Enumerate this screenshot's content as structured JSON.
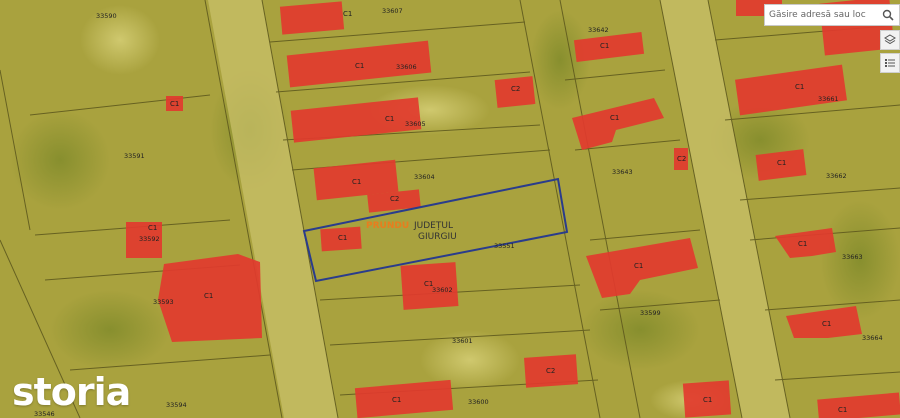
{
  "search": {
    "placeholder": "Găsire adresă sau loc"
  },
  "toolbar": {
    "icons": [
      "search-icon",
      "layers-icon",
      "legend-icon"
    ]
  },
  "logo": {
    "text": "storia"
  },
  "locality": {
    "name": "PRUNDU",
    "county_line1": "JUDEȚUL",
    "county_line2": "GIURGIU"
  },
  "colors": {
    "building": "#e23a2e",
    "parcel_highlight": "#2a3c8c",
    "base": "#a9a23e"
  },
  "parcels": [
    {
      "id": "33590",
      "label": "33590"
    },
    {
      "id": "33607",
      "label": "33607"
    },
    {
      "id": "33606",
      "label": "33606"
    },
    {
      "id": "33605",
      "label": "33605"
    },
    {
      "id": "33604",
      "label": "33604"
    },
    {
      "id": "33591",
      "label": "33591"
    },
    {
      "id": "33592",
      "label": "33592"
    },
    {
      "id": "33593",
      "label": "33593"
    },
    {
      "id": "33602",
      "label": "33602"
    },
    {
      "id": "33601",
      "label": "33601"
    },
    {
      "id": "33600",
      "label": "33600"
    },
    {
      "id": "33599",
      "label": "33599"
    },
    {
      "id": "33594",
      "label": "33594"
    },
    {
      "id": "33546",
      "label": "33546"
    },
    {
      "id": "33642",
      "label": "33642"
    },
    {
      "id": "33643",
      "label": "33643"
    },
    {
      "id": "33661",
      "label": "33661"
    },
    {
      "id": "33662",
      "label": "33662"
    },
    {
      "id": "33663",
      "label": "33663"
    },
    {
      "id": "33664",
      "label": "33664"
    },
    {
      "id": "33551",
      "label": "33551"
    }
  ],
  "buildings": [
    {
      "id": "b-33607",
      "label": "C1"
    },
    {
      "id": "b-33606",
      "label": "C1"
    },
    {
      "id": "b-33605",
      "label": "C1"
    },
    {
      "id": "b-33605-2",
      "label": "C2"
    },
    {
      "id": "b-33604",
      "label": "C1"
    },
    {
      "id": "b-33604-2",
      "label": "C2"
    },
    {
      "id": "b-33590",
      "label": "C1"
    },
    {
      "id": "b-33592",
      "label": "C1"
    },
    {
      "id": "b-33593",
      "label": "C1"
    },
    {
      "id": "b-target",
      "label": "C1"
    },
    {
      "id": "b-33602",
      "label": "C1"
    },
    {
      "id": "b-33600",
      "label": "C1"
    },
    {
      "id": "b-33601",
      "label": "C2"
    },
    {
      "id": "b-33642",
      "label": "C1"
    },
    {
      "id": "b-33643",
      "label": "C1"
    },
    {
      "id": "b-33643-2",
      "label": "C2"
    },
    {
      "id": "b-33599",
      "label": "C1"
    },
    {
      "id": "b-33661",
      "label": "C1"
    },
    {
      "id": "b-33662",
      "label": "C1"
    },
    {
      "id": "b-33663",
      "label": "C1"
    },
    {
      "id": "b-33664",
      "label": "C1"
    },
    {
      "id": "b-33599-2",
      "label": "C1"
    },
    {
      "id": "b-bottom-right",
      "label": "C1"
    }
  ]
}
